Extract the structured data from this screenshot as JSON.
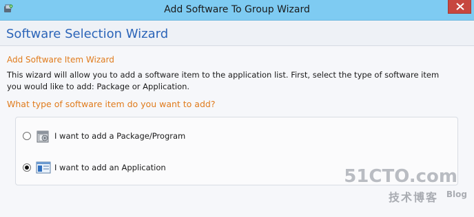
{
  "window": {
    "title": "Add Software To Group Wizard",
    "close_icon": "close-icon",
    "app_icon": "wizard-app-icon"
  },
  "header": {
    "title": "Software Selection Wizard"
  },
  "content": {
    "subtitle": "Add Software Item Wizard",
    "description": "This wizard will allow you to add a software item to the application list.  First, select the type of software item you would like to add: Package or Application.",
    "question": "What type of software item do you want to add?"
  },
  "options": [
    {
      "label": "I want to add a Package/Program",
      "selected": false,
      "icon": "package-icon"
    },
    {
      "label": "I want to add an Application",
      "selected": true,
      "icon": "application-icon"
    }
  ],
  "watermark": {
    "main": "51CTO.com",
    "sub": "技术博客",
    "blog": "Blog"
  },
  "colors": {
    "titlebar": "#7ecbf2",
    "header_text": "#2b64b8",
    "accent_orange": "#e07b1c",
    "close_button": "#c7473f"
  }
}
